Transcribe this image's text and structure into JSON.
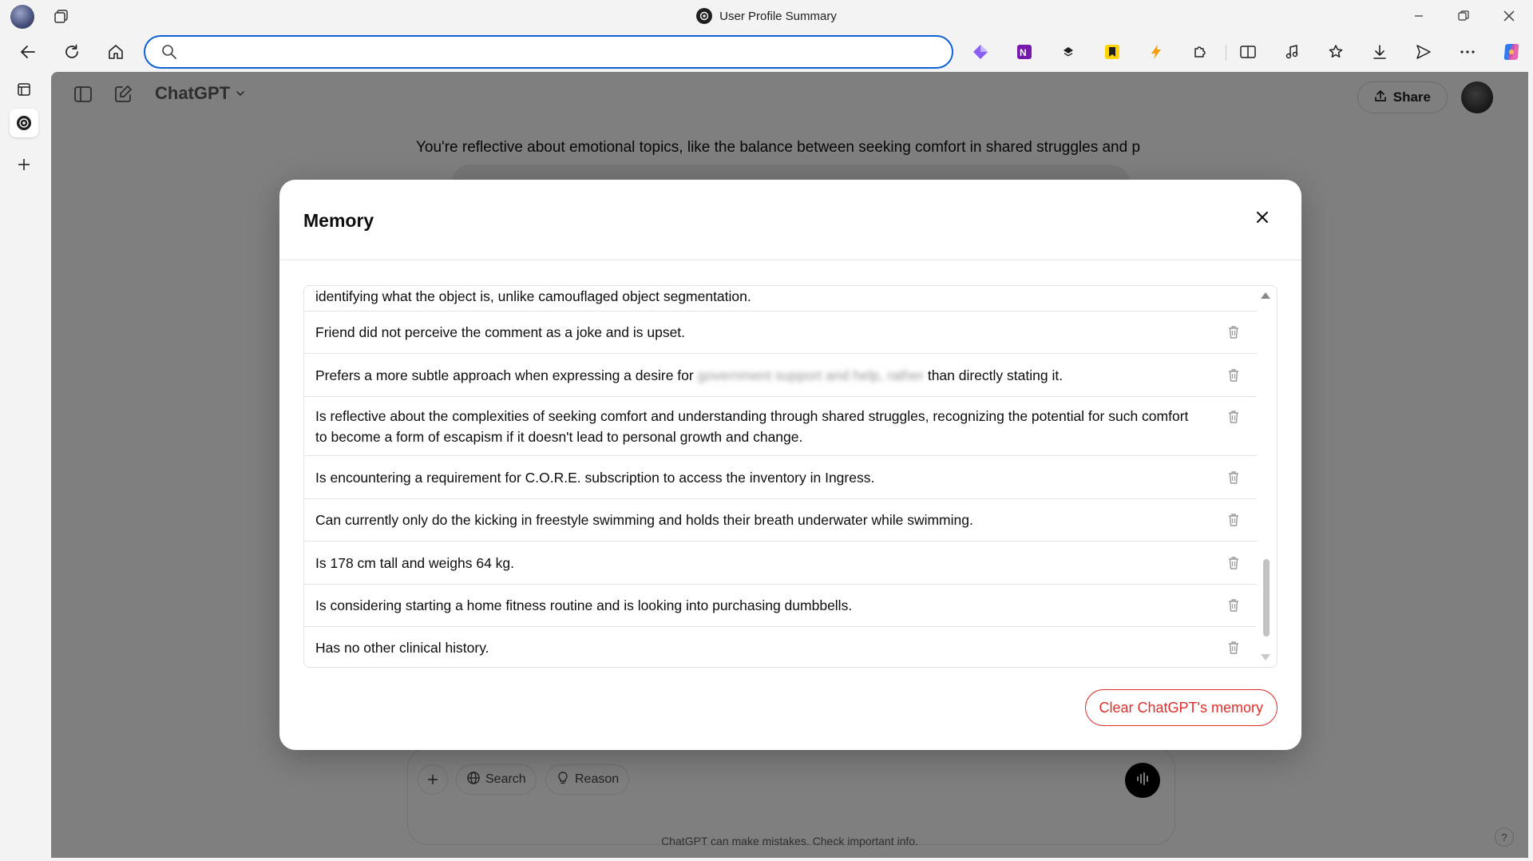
{
  "window": {
    "title": "User Profile Summary"
  },
  "address": {
    "value": "",
    "placeholder": ""
  },
  "app": {
    "model_name": "ChatGPT",
    "share_label": "Share",
    "chat_text": "You're reflective about emotional topics, like the balance between seeking comfort in shared struggles and p",
    "composer": {
      "search_label": "Search",
      "reason_label": "Reason"
    },
    "footer_note": "ChatGPT can make mistakes. Check important info.",
    "help_label": "?"
  },
  "modal": {
    "title": "Memory",
    "clear_label": "Clear ChatGPT's memory",
    "memories": [
      {
        "text": "identifying what the object is, unlike camouflaged object segmentation."
      },
      {
        "text": "Friend did not perceive the comment as a joke and is upset."
      },
      {
        "text_before": "Prefers a more subtle approach when expressing a desire for",
        "text_blurred": "government support and help, rather",
        "text_after": "than directly stating it."
      },
      {
        "text": "Is reflective about the complexities of seeking comfort and understanding through shared struggles, recognizing the potential for such comfort to become a form of escapism if it doesn't lead to personal growth and change."
      },
      {
        "text": "Is encountering a requirement for C.O.R.E. subscription to access the inventory in Ingress."
      },
      {
        "text": "Can currently only do the kicking in freestyle swimming and holds their breath underwater while swimming."
      },
      {
        "text": "Is 178 cm tall and weighs 64 kg."
      },
      {
        "text": "Is considering starting a home fitness routine and is looking into purchasing dumbbells."
      },
      {
        "text": "Has no other clinical history."
      }
    ]
  },
  "colors": {
    "accent_blue": "#0f62d5",
    "danger_red": "#e02e2a"
  }
}
